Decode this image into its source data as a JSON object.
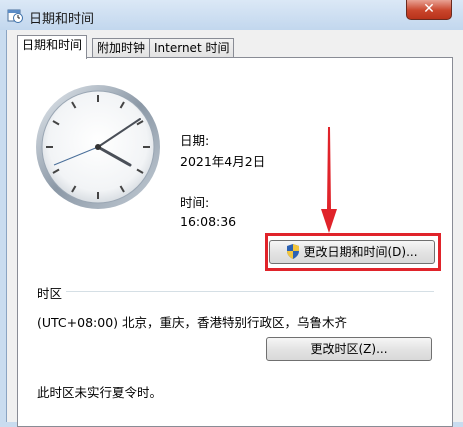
{
  "window": {
    "title": "日期和时间",
    "close_glyph": "✕"
  },
  "tabs": [
    {
      "label": "日期和时间",
      "active": true
    },
    {
      "label": "附加时钟",
      "active": false
    },
    {
      "label": "Internet 时间",
      "active": false
    }
  ],
  "date_time": {
    "date_label": "日期:",
    "date_value": "2021年4月2日",
    "time_label": "时间:",
    "time_value": "16:08:36",
    "change_button": "更改日期和时间(D)..."
  },
  "timezone": {
    "section_label": "时区",
    "value": "(UTC+08:00) 北京，重庆，香港特别行政区，乌鲁木齐",
    "change_button": "更改时区(Z)...",
    "dst_note": "此时区未实行夏令时。"
  },
  "icons": {
    "app": "date-time-icon",
    "shield": "uac-shield-icon",
    "arrow": "red-arrow-annotation"
  },
  "colors": {
    "annotation_red": "#e0232a",
    "title_bar": "#c2d7ee"
  }
}
